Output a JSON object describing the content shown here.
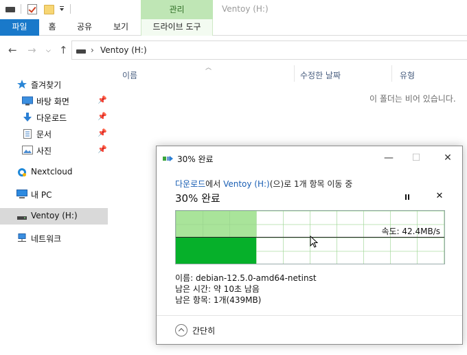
{
  "window": {
    "title": "Ventoy (H:)",
    "context_tab_group": "관리"
  },
  "ribbon": {
    "tabs": [
      "파일",
      "홈",
      "공유",
      "보기",
      "드라이브 도구"
    ]
  },
  "address": {
    "path": "Ventoy (H:)"
  },
  "sidebar": {
    "quick_access": "즐겨찾기",
    "items": [
      {
        "label": "바탕 화면",
        "icon": "desktop-icon",
        "pinned": true
      },
      {
        "label": "다운로드",
        "icon": "download-arrow-icon",
        "pinned": true
      },
      {
        "label": "문서",
        "icon": "document-icon",
        "pinned": true
      },
      {
        "label": "사진",
        "icon": "picture-icon",
        "pinned": true
      }
    ],
    "nextcloud": "Nextcloud",
    "this_pc": "내 PC",
    "drive": "Ventoy (H:)",
    "network": "네트워크"
  },
  "list": {
    "columns": [
      "이름",
      "수정한 날짜",
      "유형"
    ],
    "empty_message": "이 폴더는 비어 있습니다."
  },
  "dialog": {
    "title": "30% 완료",
    "source": "다운로드",
    "source_suffix": "에서 ",
    "destination": "Ventoy (H:)",
    "destination_suffix": "(으)로 1개 항목 이동 중",
    "percent_label": "30% 완료",
    "progress_fraction": 0.3,
    "speed": "속도: 42.4MB/s",
    "name_line": "이름: debian-12.5.0-amd64-netinst",
    "time_line": "남은 시간: 약 10초 남음",
    "items_line": "남은 항목: 1개(439MB)",
    "collapse_label": "간단히"
  },
  "colors": {
    "accent": "#1979ca",
    "context_tab": "#bfe6b5",
    "progress_fill": "#a9e49a",
    "speed_bar": "#06b02a",
    "link": "#1a5fb4"
  }
}
